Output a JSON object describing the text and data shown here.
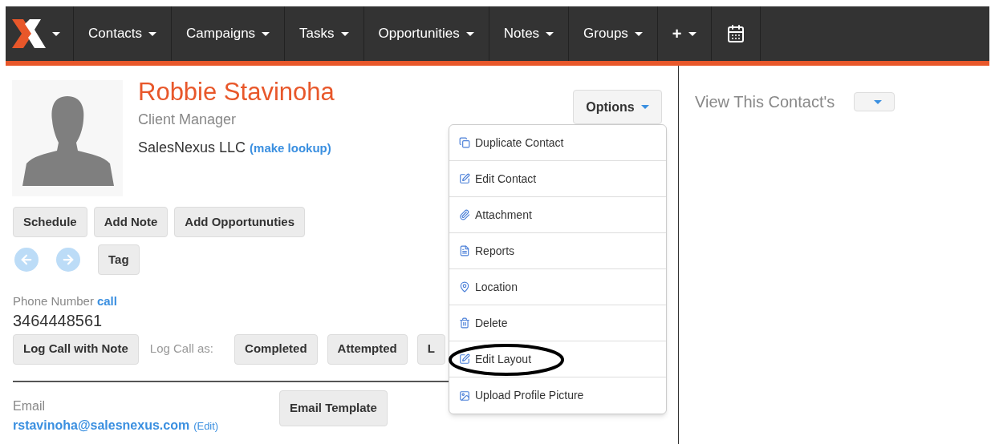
{
  "navbar": {
    "items": [
      {
        "kind": "logo"
      },
      {
        "kind": "menu",
        "label": "Contacts"
      },
      {
        "kind": "menu",
        "label": "Campaigns"
      },
      {
        "kind": "menu",
        "label": "Tasks"
      },
      {
        "kind": "menu",
        "label": "Opportunities"
      },
      {
        "kind": "menu",
        "label": "Notes"
      },
      {
        "kind": "menu",
        "label": "Groups"
      },
      {
        "kind": "menu",
        "label": "+"
      },
      {
        "kind": "calendar"
      }
    ]
  },
  "contact": {
    "name": "Robbie Stavinoha",
    "title": "Client Manager",
    "company": "SalesNexus LLC",
    "company_link": "(make lookup)",
    "actions": [
      "Schedule",
      "Add Note",
      "Add Opportunuties"
    ],
    "tag_button": "Tag",
    "phone_label": "Phone Number",
    "phone_link": "call",
    "phone": "3464448561",
    "log_note_button": "Log Call with Note",
    "log_as_label": "Log Call as:",
    "log_buttons": [
      "Completed",
      "Attempted",
      "L"
    ],
    "email_label": "Email",
    "email": "rstavinoha@salesnexus.com",
    "email_edit": "(Edit)",
    "email_template_button": "Email Template"
  },
  "options": {
    "label": "Options",
    "menu": [
      {
        "label": "Duplicate Contact",
        "circled": false
      },
      {
        "label": "Edit Contact",
        "circled": false
      },
      {
        "label": "Attachment",
        "circled": false
      },
      {
        "label": "Reports",
        "circled": false
      },
      {
        "label": "Location",
        "circled": false
      },
      {
        "label": "Delete",
        "circled": false
      },
      {
        "label": "Edit Layout",
        "circled": true
      },
      {
        "label": "Upload Profile Picture",
        "circled": false
      }
    ]
  },
  "side": {
    "label": "View This Contact's"
  }
}
